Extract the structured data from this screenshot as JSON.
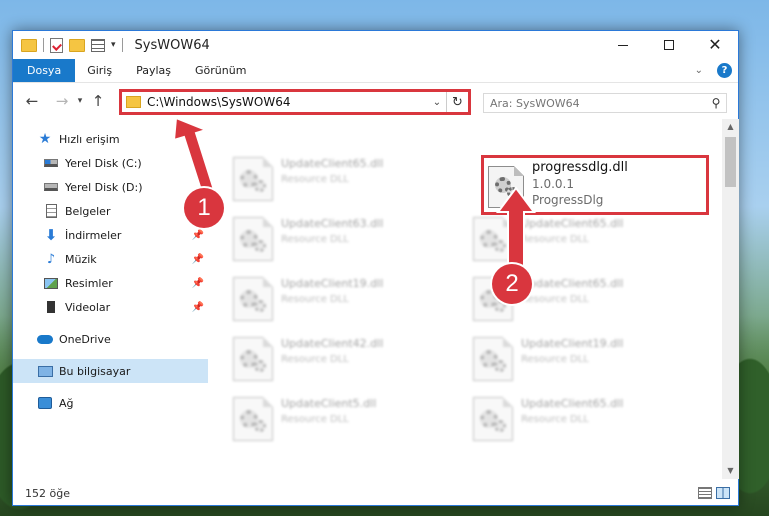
{
  "window": {
    "title": "SysWOW64"
  },
  "ribbon": {
    "tabs": [
      {
        "label": "Dosya"
      },
      {
        "label": "Giriş"
      },
      {
        "label": "Paylaş"
      },
      {
        "label": "Görünüm"
      }
    ],
    "help_label": "?"
  },
  "nav": {
    "address": "C:\\Windows\\SysWOW64",
    "search_placeholder": "Ara: SysWOW64"
  },
  "sidebar": {
    "items": [
      {
        "label": "Hızlı erişim",
        "icon": "star-icon"
      },
      {
        "label": "Yerel Disk (C:)",
        "icon": "drive-icon"
      },
      {
        "label": "Yerel Disk (D:)",
        "icon": "drive-icon"
      },
      {
        "label": "Belgeler",
        "icon": "documents-icon"
      },
      {
        "label": "İndirmeler",
        "icon": "downloads-icon"
      },
      {
        "label": "Müzik",
        "icon": "music-icon"
      },
      {
        "label": "Resimler",
        "icon": "pictures-icon"
      },
      {
        "label": "Videolar",
        "icon": "videos-icon"
      },
      {
        "label": "OneDrive",
        "icon": "cloud-icon"
      },
      {
        "label": "Bu bilgisayar",
        "icon": "computer-icon"
      },
      {
        "label": "Ağ",
        "icon": "network-icon"
      }
    ]
  },
  "files": {
    "left_column": [
      {
        "name": "UpdateClient65.dll",
        "desc": "Resource DLL"
      },
      {
        "name": "UpdateClient63.dll",
        "desc": "Resource DLL"
      },
      {
        "name": "UpdateClient19.dll",
        "desc": "Resource DLL"
      },
      {
        "name": "UpdateClient42.dll",
        "desc": "Resource DLL"
      },
      {
        "name": "UpdateClient5.dll",
        "desc": "Resource DLL"
      }
    ],
    "right_column": [
      {
        "name": "UpdateClient65.dll",
        "desc": "Resource DLL"
      },
      {
        "name": "UpdateClient65.dll",
        "desc": "Resource DLL"
      },
      {
        "name": "UpdateClient19.dll",
        "desc": "Resource DLL"
      },
      {
        "name": "UpdateClient65.dll",
        "desc": "Resource DLL"
      }
    ],
    "highlighted": {
      "name": "progressdlg.dll",
      "version": "1.0.0.1",
      "desc": "ProgressDlg"
    }
  },
  "status": {
    "item_count": "152 öğe"
  },
  "annotations": {
    "step1": "1",
    "step2": "2",
    "color": "#d9363e"
  }
}
